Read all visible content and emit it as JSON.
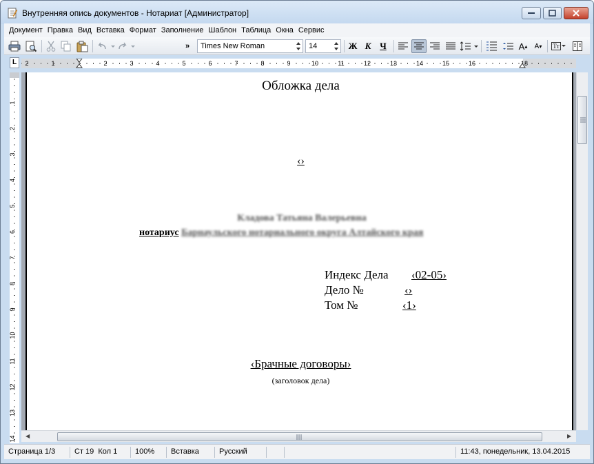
{
  "window": {
    "title": "Внутренняя опись документов - Нотариат [Администратор]"
  },
  "menu": [
    "Документ",
    "Правка",
    "Вид",
    "Вставка",
    "Формат",
    "Заполнение",
    "Шаблон",
    "Таблица",
    "Окна",
    "Сервис"
  ],
  "toolbar": {
    "more_label": "»",
    "font_name": "Times New Roman",
    "font_size": "14",
    "bold_label": "Ж",
    "italic_label": "К",
    "underline_label": "Ч",
    "font_grow_label": "A",
    "font_shrink_label": "A",
    "text_label": "Tт",
    "icons": [
      "print-icon",
      "print-preview-icon",
      "cut-icon",
      "copy-icon",
      "paste-icon",
      "undo-icon",
      "redo-icon",
      "align-left-icon",
      "align-center-icon",
      "align-right-icon",
      "align-justify-icon",
      "line-spacing-icon",
      "numbered-list-icon",
      "bulleted-list-icon",
      "grow-font-icon",
      "shrink-font-icon",
      "case-icon",
      "columns-icon"
    ],
    "active_alignment": "center"
  },
  "ruler": {
    "corner_label": "L",
    "h_numbers": [
      "2",
      "1",
      "1",
      "2",
      "3",
      "4",
      "5",
      "6",
      "7",
      "8",
      "9",
      "10",
      "11",
      "12",
      "13",
      "14",
      "15",
      "16",
      "18"
    ],
    "v_numbers": [
      "1",
      "2",
      "3",
      "4",
      "5",
      "6",
      "7",
      "8",
      "9",
      "10",
      "11",
      "12",
      "13",
      "14"
    ]
  },
  "document": {
    "title": "Обложка дела",
    "code_mark": "‹›",
    "notary_name": "Кладова Татьяна Валерьевна",
    "notary_label": "нотариус",
    "notary_district": "Барнаульского нотариального округа Алтайского края",
    "index_label": "Индекс Дела",
    "index_value": "‹02-05›",
    "case_label": "Дело №",
    "case_value": "‹›",
    "volume_label": "Том №",
    "volume_value": "‹1›",
    "case_heading": "‹Брачные договоры›",
    "case_heading_caption": "(заголовок дела)"
  },
  "statusbar": {
    "page": "Страница 1/3",
    "position": "Ст 19  Кол 1",
    "zoom": "100%",
    "mode": "Вставка",
    "language": "Русский",
    "datetime": "11:43, понедельник, 13.04.2015"
  },
  "colors": {
    "frame": "#c9dcf0",
    "menubar": "#f2f4f7",
    "doc_background": "#a4aab3",
    "close_button": "#c4412c"
  }
}
